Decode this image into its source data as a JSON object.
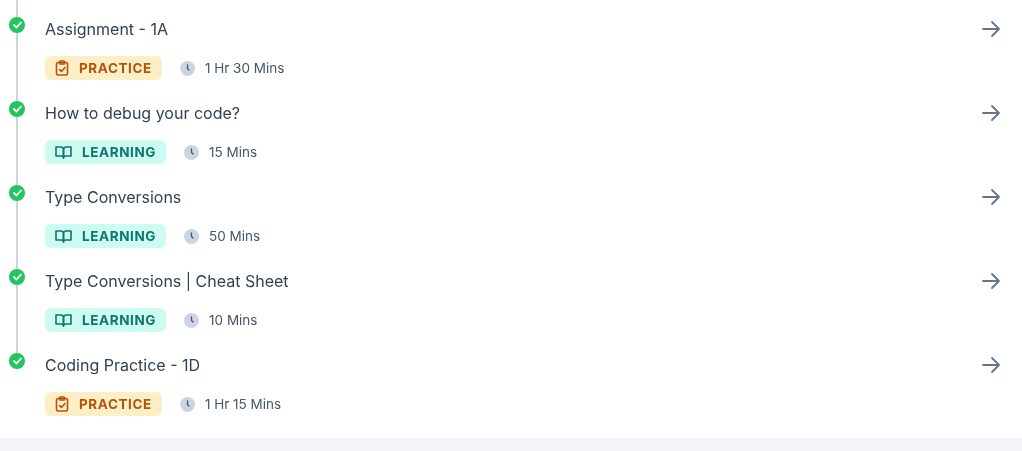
{
  "items": [
    {
      "title": "Assignment - 1A",
      "completed": true,
      "badge": {
        "kind": "practice",
        "label": "PRACTICE"
      },
      "duration": "1 Hr 30 Mins"
    },
    {
      "title": "How to debug your code?",
      "completed": true,
      "badge": {
        "kind": "learning",
        "label": "LEARNING"
      },
      "duration": "15 Mins"
    },
    {
      "title": "Type Conversions",
      "completed": true,
      "badge": {
        "kind": "learning",
        "label": "LEARNING"
      },
      "duration": "50 Mins"
    },
    {
      "title": "Type Conversions | Cheat Sheet",
      "completed": true,
      "badge": {
        "kind": "learning",
        "label": "LEARNING"
      },
      "duration": "10 Mins"
    },
    {
      "title": "Coding Practice - 1D",
      "completed": true,
      "badge": {
        "kind": "practice",
        "label": "PRACTICE"
      },
      "duration": "1 Hr 15 Mins"
    }
  ]
}
